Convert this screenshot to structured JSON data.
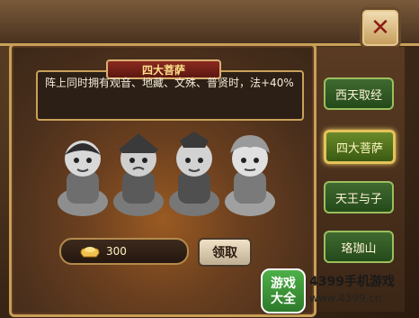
{
  "title": "四大菩萨",
  "description": "阵上同时拥有观音、地藏、文殊、普贤时，法+40%",
  "close_icon": "close-icon",
  "resource": {
    "icon": "gold-ingot-icon",
    "value": "300"
  },
  "claim_button": "领取",
  "tabs": [
    {
      "label": "西天取经"
    },
    {
      "label": "四大菩萨"
    },
    {
      "label": "天王与子"
    },
    {
      "label": "珞珈山"
    }
  ],
  "watermark": {
    "badge_line1": "游戏",
    "badge_line2": "大全",
    "brand": "4399手机游戏",
    "url": "www.4399.cn"
  },
  "colors": {
    "panel_brown": "#4a2f1c",
    "gold_border": "#c99e57",
    "tab_green": "#3f6a2f",
    "title_red": "#8a2a1f"
  }
}
